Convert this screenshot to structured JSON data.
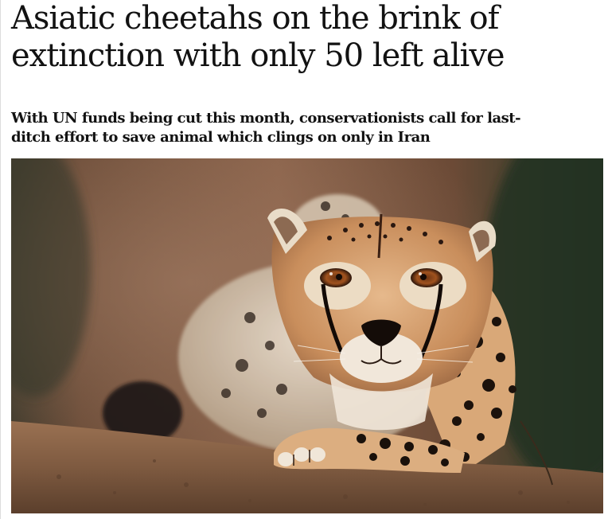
{
  "article": {
    "headline": "Asiatic cheetahs on the brink of extinction with only 50 left alive",
    "standfirst": "With UN funds being cut this month, conservationists call for last-ditch effort to save animal which clings on only in Iran"
  },
  "image": {
    "subject": "cheetah"
  }
}
